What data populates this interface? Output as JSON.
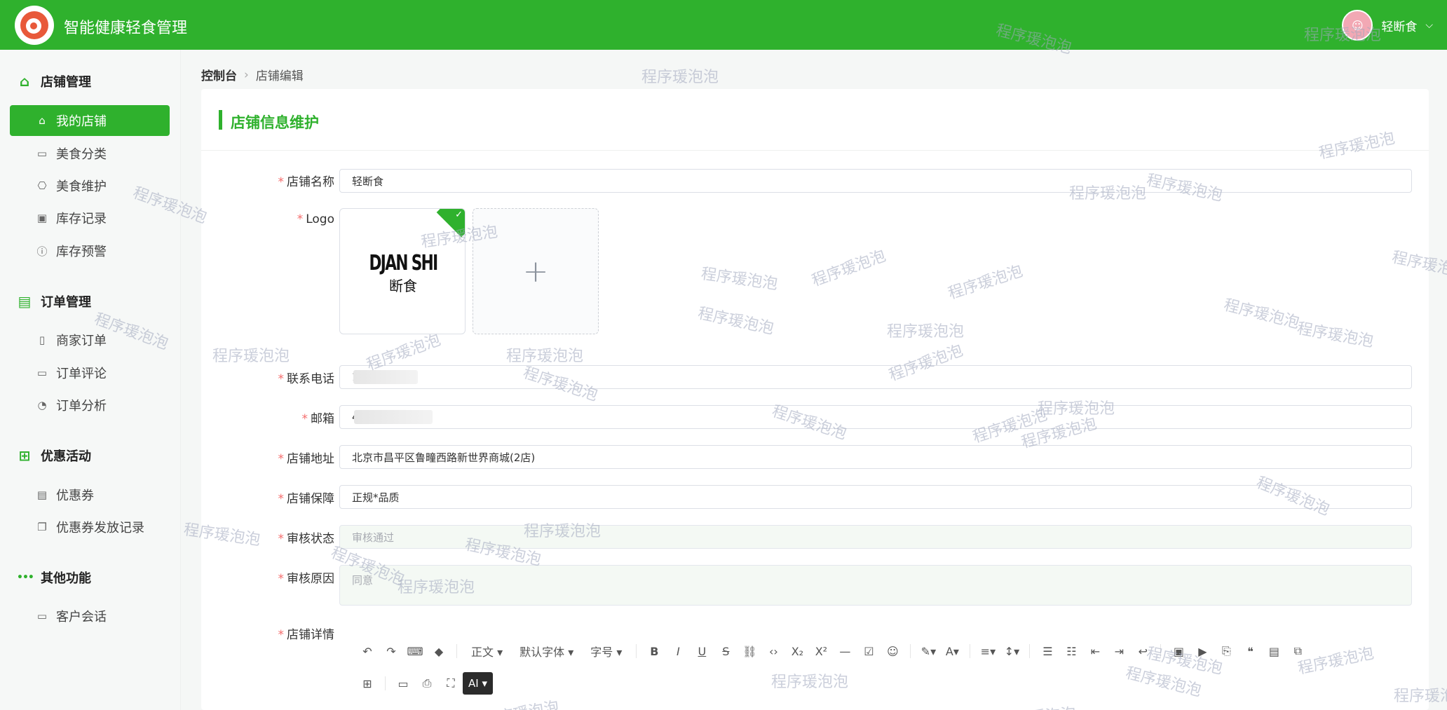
{
  "header": {
    "app_title": "智能健康轻食管理",
    "user_name": "轻断食",
    "avatar_glyph": "☺",
    "chevron": "⌵",
    "brand_color": "#2fb12d"
  },
  "sidebar": {
    "groups": [
      {
        "title": "店铺管理",
        "icon": "shop-icon",
        "glyph": "⌂",
        "items": [
          {
            "label": "我的店铺",
            "icon": "shop-icon",
            "glyph": "⌂"
          },
          {
            "label": "美食分类",
            "icon": "category-icon",
            "glyph": "▭"
          },
          {
            "label": "美食维护",
            "icon": "bag-icon",
            "glyph": "⎔"
          },
          {
            "label": "库存记录",
            "icon": "box-icon",
            "glyph": "▣"
          },
          {
            "label": "库存预警",
            "icon": "warning-icon",
            "glyph": "ⓘ"
          }
        ]
      },
      {
        "title": "订单管理",
        "icon": "clipboard-icon",
        "glyph": "▤",
        "items": [
          {
            "label": "商家订单",
            "icon": "document-icon",
            "glyph": "▯"
          },
          {
            "label": "订单评论",
            "icon": "comment-icon",
            "glyph": "▭"
          },
          {
            "label": "订单分析",
            "icon": "chart-pie-icon",
            "glyph": "◔"
          }
        ]
      },
      {
        "title": "优惠活动",
        "icon": "gift-icon",
        "glyph": "⊞",
        "items": [
          {
            "label": "优惠券",
            "icon": "ticket-icon",
            "glyph": "▤"
          },
          {
            "label": "优惠券发放记录",
            "icon": "copy-icon",
            "glyph": "❐"
          }
        ]
      },
      {
        "title": "其他功能",
        "icon": "more-icon",
        "glyph": "•••",
        "items": [
          {
            "label": "客户会话",
            "icon": "chat-icon",
            "glyph": "▭"
          }
        ]
      }
    ]
  },
  "breadcrumb": {
    "first": "控制台",
    "sep": "›",
    "current": "店铺编辑"
  },
  "card": {
    "title": "店铺信息维护"
  },
  "form": {
    "name_label": "店铺名称",
    "name_value": "轻断食",
    "logo_label": "Logo",
    "logo_text": "DJAN SHI",
    "logo_subtext": "断食",
    "add_glyph": "+",
    "check_glyph": "✓",
    "phone_label": "联系电话",
    "phone_value": "1",
    "email_label": "邮箱",
    "email_value": "456789",
    "address_label": "店铺地址",
    "address_value": "北京市昌平区鲁疃西路新世界商城(2店)",
    "guarantee_label": "店铺保障",
    "guarantee_value": "正规*品质",
    "status_label": "审核状态",
    "status_value": "审核通过",
    "reason_label": "审核原因",
    "reason_value": "同意",
    "detail_label": "店铺详情",
    "required_mark": "*"
  },
  "editor": {
    "row1": [
      {
        "name": "undo-icon",
        "glyph": "↶"
      },
      {
        "name": "redo-icon",
        "glyph": "↷"
      },
      {
        "name": "format-painter-icon",
        "glyph": "⌨"
      },
      {
        "name": "eraser-icon",
        "glyph": "◆"
      },
      {
        "sep": true
      },
      {
        "name": "paragraph-select",
        "text": "正文 ▾"
      },
      {
        "name": "font-family-select",
        "text": "默认字体 ▾"
      },
      {
        "name": "font-size-select",
        "text": "字号 ▾"
      },
      {
        "sep": true
      },
      {
        "name": "bold-icon",
        "glyph": "B"
      },
      {
        "name": "italic-icon",
        "glyph": "I"
      },
      {
        "name": "underline-icon",
        "glyph": "U"
      },
      {
        "name": "strikethrough-icon",
        "glyph": "S"
      },
      {
        "name": "link-icon",
        "glyph": "⛓"
      },
      {
        "name": "code-icon",
        "glyph": "‹›"
      },
      {
        "name": "subscript-icon",
        "glyph": "X₂"
      },
      {
        "name": "superscript-icon",
        "glyph": "X²"
      },
      {
        "name": "divider-icon",
        "glyph": "—"
      },
      {
        "name": "todo-icon",
        "glyph": "☑"
      },
      {
        "name": "emoji-icon",
        "glyph": "☺"
      },
      {
        "sep": true
      },
      {
        "name": "highlight-icon",
        "glyph": "✎▾"
      },
      {
        "name": "font-color-icon",
        "glyph": "A▾"
      },
      {
        "sep": true
      },
      {
        "name": "align-icon",
        "glyph": "≡▾"
      },
      {
        "name": "line-height-icon",
        "glyph": "↕▾"
      },
      {
        "sep": true
      },
      {
        "name": "bullet-list-icon",
        "glyph": "☰"
      },
      {
        "name": "ordered-list-icon",
        "glyph": "☷"
      },
      {
        "name": "outdent-icon",
        "glyph": "⇤"
      },
      {
        "name": "indent-icon",
        "glyph": "⇥"
      },
      {
        "name": "wrap-icon",
        "glyph": "↩"
      },
      {
        "sep": true
      },
      {
        "name": "image-icon",
        "glyph": "▣"
      },
      {
        "name": "video-icon",
        "glyph": "▶"
      },
      {
        "name": "attachment-icon",
        "glyph": "⎘"
      },
      {
        "name": "quote-icon",
        "glyph": "❝"
      },
      {
        "name": "gallery-icon",
        "glyph": "▤"
      },
      {
        "name": "embed-icon",
        "glyph": "⧉"
      }
    ],
    "row2": [
      {
        "name": "table-icon",
        "glyph": "⊞"
      },
      {
        "sep": true
      },
      {
        "name": "preview-icon",
        "glyph": "▭"
      },
      {
        "name": "print-icon",
        "glyph": "⎙"
      },
      {
        "name": "fullscreen-icon",
        "glyph": "⛶"
      },
      {
        "name": "ai-button",
        "text": "AI ▾",
        "ai": true
      }
    ]
  },
  "watermark": "程序瑗泡泡"
}
